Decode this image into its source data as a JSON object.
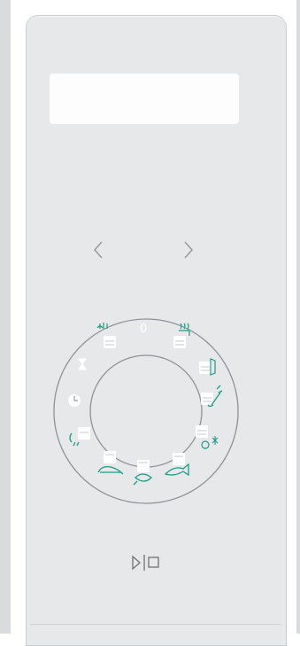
{
  "panel": {
    "display_text": "",
    "nav": {
      "prev_icon": "chevron-left-icon",
      "next_icon": "chevron-right-icon"
    },
    "dial": {
      "zero_label": "0",
      "accent_color": "#1d9b84",
      "modes": [
        "grill-top-icon",
        "hot-air-icon",
        "hot-air-baking-icon",
        "defrost-vegetables-icon",
        "defrost-bread-icon",
        "grill-fish-icon",
        "grill-poultry-icon",
        "grill-bottom-icon",
        "steam-icon",
        "clock-icon",
        "timer-icon"
      ]
    },
    "start_stop_icon": "start-stop-icon"
  }
}
